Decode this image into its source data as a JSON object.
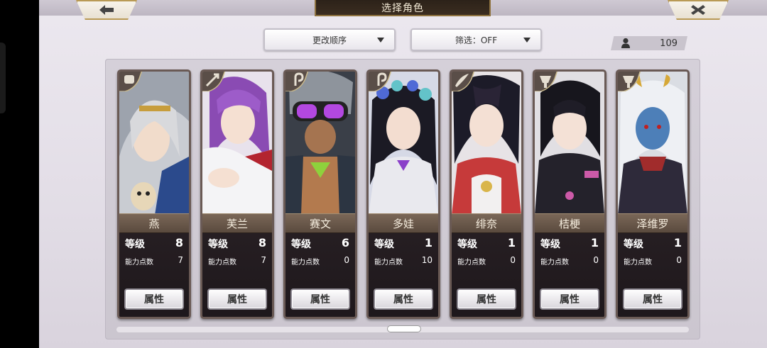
{
  "header": {
    "title": "选择角色"
  },
  "controls": {
    "sort_label": "更改顺序",
    "filter_label": "筛选：OFF",
    "character_count": "109"
  },
  "characters": [
    {
      "name": "燕",
      "level_label": "等级",
      "level": "8",
      "points_label": "能力点数",
      "points": "7",
      "button": "属性",
      "class_icon": "fist-icon"
    },
    {
      "name": "芙兰",
      "level_label": "等级",
      "level": "8",
      "points_label": "能力点数",
      "points": "7",
      "button": "属性",
      "class_icon": "arrow-icon"
    },
    {
      "name": "赛文",
      "level_label": "等级",
      "level": "6",
      "points_label": "能力点数",
      "points": "0",
      "button": "属性",
      "class_icon": "spiral-icon"
    },
    {
      "name": "多娃",
      "level_label": "等级",
      "level": "1",
      "points_label": "能力点数",
      "points": "10",
      "button": "属性",
      "class_icon": "spiral-icon"
    },
    {
      "name": "绯奈",
      "level_label": "等级",
      "level": "1",
      "points_label": "能力点数",
      "points": "0",
      "button": "属性",
      "class_icon": "blade-icon"
    },
    {
      "name": "桔梗",
      "level_label": "等级",
      "level": "1",
      "points_label": "能力点数",
      "points": "0",
      "button": "属性",
      "class_icon": "axe-icon"
    },
    {
      "name": "泽维罗",
      "level_label": "等级",
      "level": "1",
      "points_label": "能力点数",
      "points": "0",
      "button": "属性",
      "class_icon": "axe-icon"
    }
  ],
  "colors": {
    "accent_gold": "#b99a55",
    "panel_bg": "#d5d0d9",
    "card_border": "#6a5a55"
  }
}
